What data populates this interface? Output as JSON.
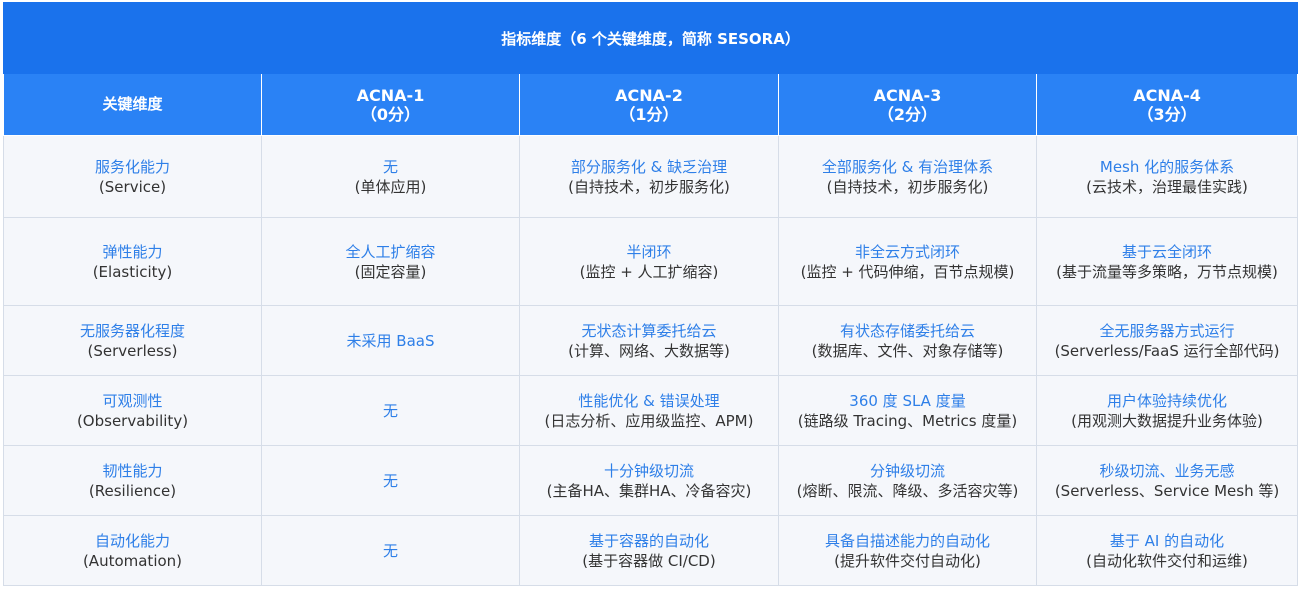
{
  "table": {
    "banner": "指标维度（6 个关键维度，简称 SESORA）",
    "header": [
      {
        "line1": "关键维度",
        "line2": ""
      },
      {
        "line1": "ACNA-1",
        "line2": "（0分）"
      },
      {
        "line1": "ACNA-2",
        "line2": "（1分）"
      },
      {
        "line1": "ACNA-3",
        "line2": "（2分）"
      },
      {
        "line1": "ACNA-4",
        "line2": "（3分）"
      }
    ],
    "rows": [
      [
        {
          "main": "服务化能力",
          "sub": "(Service)"
        },
        {
          "main": "无",
          "sub": "(单体应用)"
        },
        {
          "main": "部分服务化 & 缺乏治理",
          "sub": "(自持技术，初步服务化)"
        },
        {
          "main": "全部服务化 & 有治理体系",
          "sub": "(自持技术，初步服务化)"
        },
        {
          "main": "Mesh 化的服务体系",
          "sub": "(云技术，治理最佳实践)"
        }
      ],
      [
        {
          "main": "弹性能力",
          "sub": "(Elasticity)"
        },
        {
          "main": "全人工扩缩容",
          "sub": "(固定容量)"
        },
        {
          "main": "半闭环",
          "sub": "(监控 + 人工扩缩容)"
        },
        {
          "main": "非全云方式闭环",
          "sub": "(监控 + 代码伸缩，百节点规模)"
        },
        {
          "main": "基于云全闭环",
          "sub": "(基于流量等多策略，万节点规模)"
        }
      ],
      [
        {
          "main": "无服务器化程度",
          "sub": "(Serverless)"
        },
        {
          "main": "未采用 BaaS",
          "sub": ""
        },
        {
          "main": "无状态计算委托给云",
          "sub": "(计算、网络、大数据等)"
        },
        {
          "main": "有状态存储委托给云",
          "sub": "(数据库、文件、对象存储等)"
        },
        {
          "main": "全无服务器方式运行",
          "sub": "(Serverless/FaaS 运行全部代码)"
        }
      ],
      [
        {
          "main": "可观测性",
          "sub": "(Observability)"
        },
        {
          "main": "无",
          "sub": ""
        },
        {
          "main": "性能优化 & 错误处理",
          "sub": "(日志分析、应用级监控、APM)"
        },
        {
          "main": "360 度 SLA 度量",
          "sub": "(链路级 Tracing、Metrics 度量)"
        },
        {
          "main": "用户体验持续优化",
          "sub": "(用观测大数据提升业务体验)"
        }
      ],
      [
        {
          "main": "韧性能力",
          "sub": "(Resilience)"
        },
        {
          "main": "无",
          "sub": ""
        },
        {
          "main": "十分钟级切流",
          "sub": "(主备HA、集群HA、冷备容灾)"
        },
        {
          "main": "分钟级切流",
          "sub": "(熔断、限流、降级、多活容灾等)"
        },
        {
          "main": "秒级切流、业务无感",
          "sub": "(Serverless、Service Mesh 等)"
        }
      ],
      [
        {
          "main": "自动化能力",
          "sub": "(Automation)"
        },
        {
          "main": "无",
          "sub": ""
        },
        {
          "main": "基于容器的自动化",
          "sub": "(基于容器做 CI/CD)"
        },
        {
          "main": "具备自描述能力的自动化",
          "sub": "(提升软件交付自动化)"
        },
        {
          "main": "基于 AI 的自动化",
          "sub": "(自动化软件交付和运维)"
        }
      ]
    ]
  }
}
